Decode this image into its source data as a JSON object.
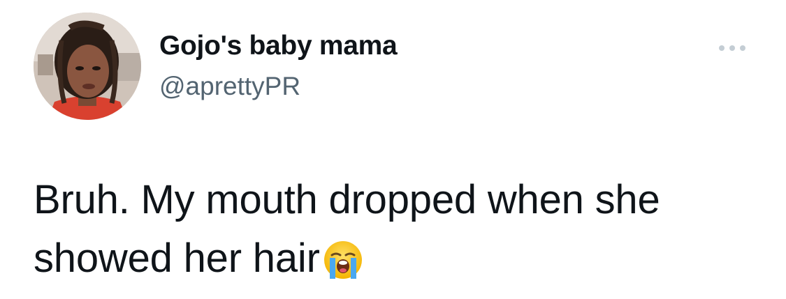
{
  "tweet": {
    "display_name": "Gojo's baby mama",
    "handle": "@aprettyPR",
    "text_line1": "Bruh. My mouth dropped when she",
    "text_line2": "showed her hair",
    "emoji": "loudly-crying-face-icon",
    "more_icon": "more-options-icon",
    "avatar_icon": "profile-photo"
  },
  "colors": {
    "text_primary": "#0f1419",
    "text_secondary": "#536471",
    "more_dots": "#c4cdd4",
    "background": "#ffffff"
  }
}
